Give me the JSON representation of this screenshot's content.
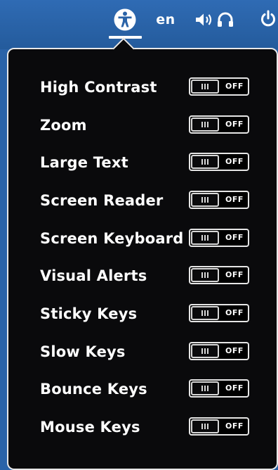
{
  "top_bar": {
    "language": "en",
    "icons": [
      "accessibility-icon",
      "volume-icon",
      "headphones-icon",
      "power-icon"
    ]
  },
  "a11y_menu": {
    "items": [
      {
        "label": "High Contrast",
        "state": "OFF"
      },
      {
        "label": "Zoom",
        "state": "OFF"
      },
      {
        "label": "Large Text",
        "state": "OFF"
      },
      {
        "label": "Screen Reader",
        "state": "OFF"
      },
      {
        "label": "Screen Keyboard",
        "state": "OFF"
      },
      {
        "label": "Visual Alerts",
        "state": "OFF"
      },
      {
        "label": "Sticky Keys",
        "state": "OFF"
      },
      {
        "label": "Slow Keys",
        "state": "OFF"
      },
      {
        "label": "Bounce Keys",
        "state": "OFF"
      },
      {
        "label": "Mouse Keys",
        "state": "OFF"
      }
    ]
  },
  "colors": {
    "top_bar": "#2a63a8",
    "menu_background": "#0a0a0c",
    "menu_border": "#e8e8e8",
    "text": "#ffffff"
  }
}
